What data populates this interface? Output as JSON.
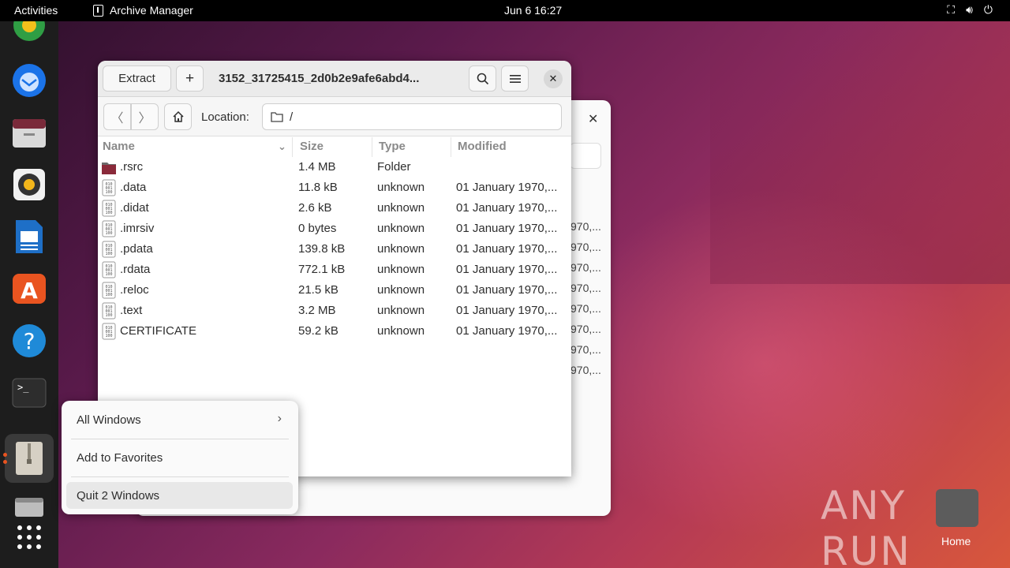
{
  "topbar": {
    "activities": "Activities",
    "app_name": "Archive Manager",
    "clock": "Jun 6  16:27"
  },
  "window": {
    "extract_label": "Extract",
    "add_label": "+",
    "title": "3152_31725415_2d0b2e9afe6abd4...",
    "location_label": "Location:",
    "location_value": "/",
    "columns": {
      "name": "Name",
      "size": "Size",
      "type": "Type",
      "modified": "Modified"
    },
    "rows": [
      {
        "name": ".rsrc",
        "size": "1.4 MB",
        "type": "Folder",
        "modified": "",
        "icon": "folder-icon"
      },
      {
        "name": ".data",
        "size": "11.8 kB",
        "type": "unknown",
        "modified": "01 January 1970,...",
        "icon": "binary-file-icon"
      },
      {
        "name": ".didat",
        "size": "2.6 kB",
        "type": "unknown",
        "modified": "01 January 1970,...",
        "icon": "binary-file-icon"
      },
      {
        "name": ".imrsiv",
        "size": "0 bytes",
        "type": "unknown",
        "modified": "01 January 1970,...",
        "icon": "binary-file-icon"
      },
      {
        "name": ".pdata",
        "size": "139.8 kB",
        "type": "unknown",
        "modified": "01 January 1970,...",
        "icon": "binary-file-icon"
      },
      {
        "name": ".rdata",
        "size": "772.1 kB",
        "type": "unknown",
        "modified": "01 January 1970,...",
        "icon": "binary-file-icon"
      },
      {
        "name": ".reloc",
        "size": "21.5 kB",
        "type": "unknown",
        "modified": "01 January 1970,...",
        "icon": "binary-file-icon"
      },
      {
        "name": ".text",
        "size": "3.2 MB",
        "type": "unknown",
        "modified": "01 January 1970,...",
        "icon": "binary-file-icon"
      },
      {
        "name": "CERTIFICATE",
        "size": "59.2 kB",
        "type": "unknown",
        "modified": "01 January 1970,...",
        "icon": "binary-file-icon"
      }
    ]
  },
  "back_window": {
    "rows": [
      "970,...",
      "970,...",
      "970,...",
      "970,...",
      "970,...",
      "970,...",
      "970,...",
      "970,..."
    ]
  },
  "context_menu": {
    "all_windows": "All Windows",
    "add_favorites": "Add to Favorites",
    "quit": "Quit 2 Windows"
  },
  "desktop": {
    "watermark": "ANY RUN",
    "home_label": "Home"
  },
  "colors": {
    "accent": "#e95420",
    "dock_bg": "#1d1d1d",
    "topbar_bg": "#000000"
  }
}
